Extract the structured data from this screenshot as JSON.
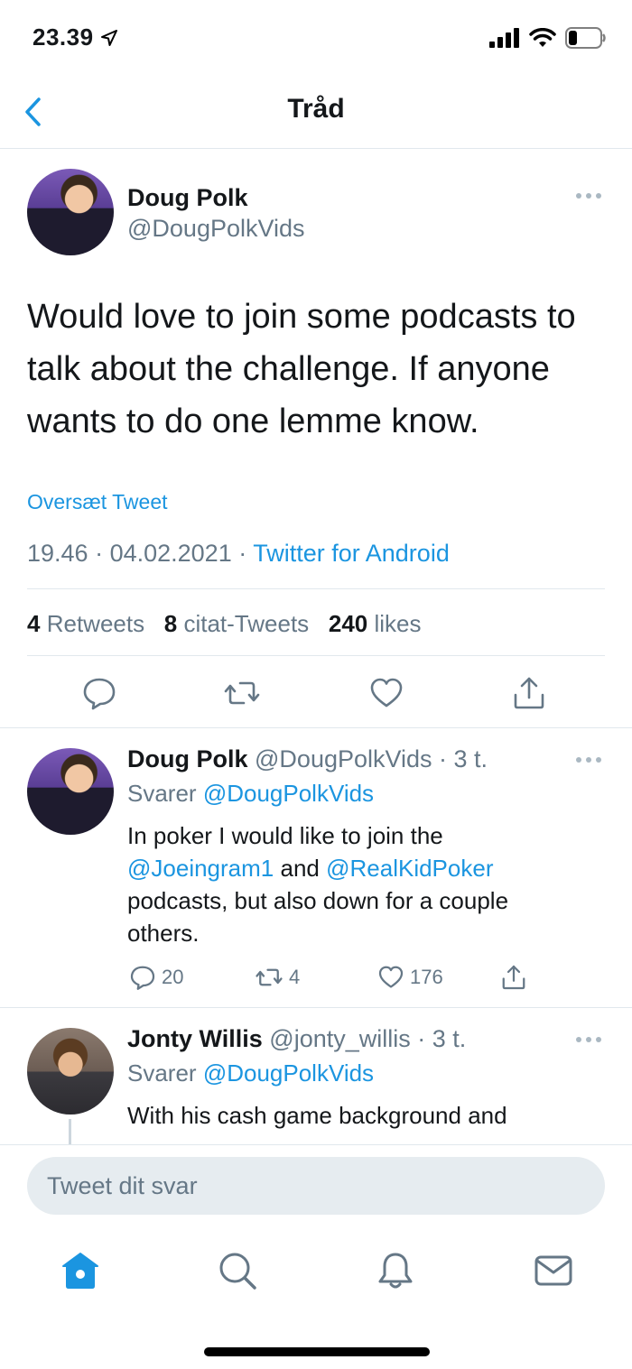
{
  "status": {
    "time": "23.39"
  },
  "nav": {
    "title": "Tråd"
  },
  "main_tweet": {
    "name": "Doug Polk",
    "handle": "@DougPolkVids",
    "text": "Would love to join some podcasts to talk about the challenge. If anyone wants to do one lemme know.",
    "translate_label": "Oversæt Tweet",
    "time": "19.46",
    "date": "04.02.2021",
    "source": "Twitter for Android",
    "retweets_count": "4",
    "retweets_label": "Retweets",
    "quotes_count": "8",
    "quotes_label": "citat-Tweets",
    "likes_count": "240",
    "likes_label": "likes"
  },
  "replies": [
    {
      "name": "Doug Polk",
      "handle": "@DougPolkVids",
      "age": "3 t.",
      "replying_prefix": "Svarer",
      "replying_to": "@DougPolkVids",
      "text_1": "In poker I would like to join the",
      "mention_1": "@Joeingram1",
      "and": "and",
      "mention_2": "@RealKidPoker",
      "text_2": "podcasts, but also down for a couple others.",
      "replies": "20",
      "retweets": "4",
      "likes": "176"
    },
    {
      "name": "Jonty Willis",
      "handle": "@jonty_willis",
      "age": "3 t.",
      "replying_prefix": "Svarer",
      "replying_to": "@DougPolkVids",
      "text": "With his cash game background and"
    }
  ],
  "compose": {
    "placeholder": "Tweet dit svar"
  },
  "colors": {
    "accent": "#1b95e0",
    "secondary": "#657786",
    "divider": "#e1e8ed"
  },
  "icons": [
    "back-chevron-icon",
    "reply-icon",
    "retweet-icon",
    "like-icon",
    "share-icon",
    "more-icon",
    "home-icon",
    "search-icon",
    "notifications-icon",
    "messages-icon"
  ]
}
